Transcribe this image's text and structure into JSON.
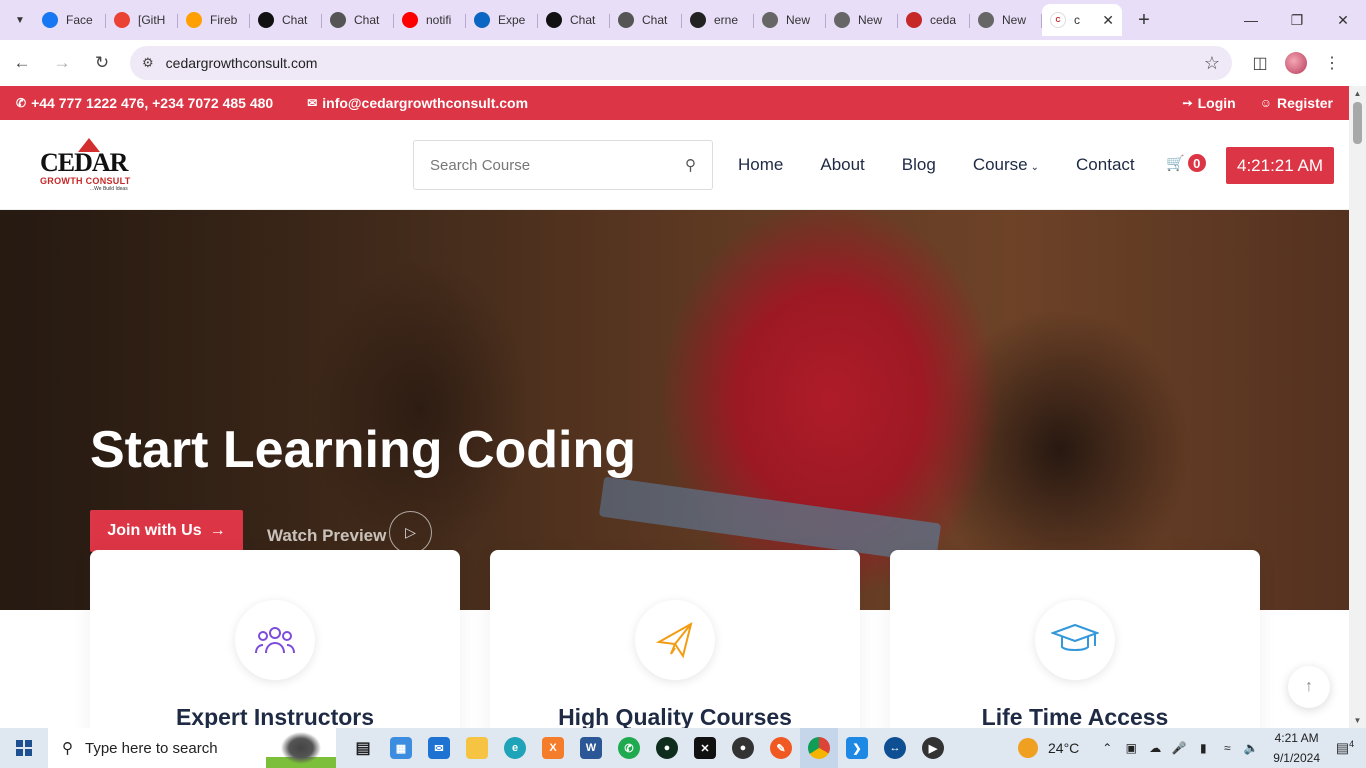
{
  "browser": {
    "tabs": [
      {
        "label": "Face",
        "icon": "facebook-icon",
        "color": "#1877f2"
      },
      {
        "label": "[GitH",
        "icon": "gmail-icon",
        "color": "#ea4335"
      },
      {
        "label": "Fireb",
        "icon": "firebase-icon",
        "color": "#ffa000"
      },
      {
        "label": "Chat",
        "icon": "chatgpt-icon",
        "color": "#111111"
      },
      {
        "label": "Chat",
        "icon": "chatgpt-icon",
        "color": "#555555"
      },
      {
        "label": "notifi",
        "icon": "youtube-icon",
        "color": "#ff0000"
      },
      {
        "label": "Expe",
        "icon": "linkedin-icon",
        "color": "#0a66c2"
      },
      {
        "label": "Chat",
        "icon": "chatgpt-icon",
        "color": "#111111"
      },
      {
        "label": "Chat",
        "icon": "chatgpt-icon",
        "color": "#555555"
      },
      {
        "label": "erne",
        "icon": "github-icon",
        "color": "#222222"
      },
      {
        "label": "New",
        "icon": "globe-icon",
        "color": "#666666"
      },
      {
        "label": "New",
        "icon": "globe-icon",
        "color": "#666666"
      },
      {
        "label": "ceda",
        "icon": "cedar-favicon-icon",
        "color": "#c62828"
      },
      {
        "label": "New",
        "icon": "globe-icon",
        "color": "#666666"
      }
    ],
    "active_tab": {
      "label": "c",
      "icon": "cedar-favicon-icon"
    },
    "url": "cedargrowthconsult.com"
  },
  "site": {
    "topbar": {
      "phone": "+44 777 1222 476, +234 7072 485 480",
      "email": "info@cedargrowthconsult.com",
      "login": "Login",
      "register": "Register"
    },
    "logo": {
      "mark": "CEDAR",
      "sub": "GROWTH CONSULT",
      "tag": "...We Build Ideas"
    },
    "search_placeholder": "Search Course",
    "nav": {
      "home": "Home",
      "about": "About",
      "blog": "Blog",
      "course": "Course",
      "contact": "Contact"
    },
    "cart_count": "0",
    "clock": "4:21:21 AM",
    "hero": {
      "title": "Start Learning Coding",
      "join": "Join with Us",
      "watch": "Watch Preview"
    },
    "features": [
      {
        "title": "Expert Instructors",
        "icon": "users-icon",
        "color": "#7c4ddb"
      },
      {
        "title": "High Quality Courses",
        "icon": "paper-plane-icon",
        "color": "#f39c12"
      },
      {
        "title": "Life Time Access",
        "icon": "graduation-cap-icon",
        "color": "#3498db"
      }
    ],
    "accent": "#dc3545"
  },
  "taskbar": {
    "search_placeholder": "Type here to search",
    "weather": "24°C",
    "time": "4:21 AM",
    "date": "9/1/2024",
    "notifications": "4"
  }
}
